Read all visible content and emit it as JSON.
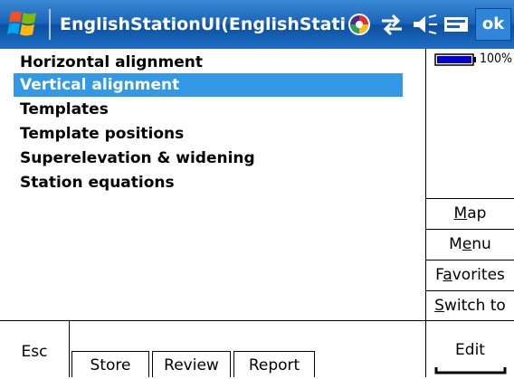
{
  "titlebar": {
    "title": "EnglishStationUI(EnglishStation",
    "ok_label": "ok"
  },
  "main_list": {
    "items": [
      {
        "label": "Horizontal alignment",
        "selected": false
      },
      {
        "label": "Vertical alignment",
        "selected": true
      },
      {
        "label": "Templates",
        "selected": false
      },
      {
        "label": "Template positions",
        "selected": false
      },
      {
        "label": "Superelevation & widening",
        "selected": false
      },
      {
        "label": "Station equations",
        "selected": false
      }
    ]
  },
  "status": {
    "battery_percent": 100,
    "battery_text": "100%"
  },
  "side_buttons": [
    {
      "pre": "",
      "ul": "M",
      "post": "ap"
    },
    {
      "pre": "M",
      "ul": "e",
      "post": "nu"
    },
    {
      "pre": "F",
      "ul": "a",
      "post": "vorites"
    },
    {
      "pre": "",
      "ul": "S",
      "post": "witch to"
    }
  ],
  "bottom_bar": {
    "esc_label": "Esc",
    "tabs": [
      "Store",
      "Review",
      "Report"
    ],
    "edit_label": "Edit"
  },
  "colors": {
    "titlebar": "#1a63b8",
    "selection": "#3399e6",
    "battery": "#0000cc"
  },
  "icons": {
    "start": "windows-flag-icon",
    "tray": [
      "color-wheel-icon",
      "connectivity-icon",
      "volume-icon",
      "keyboard-icon"
    ]
  }
}
